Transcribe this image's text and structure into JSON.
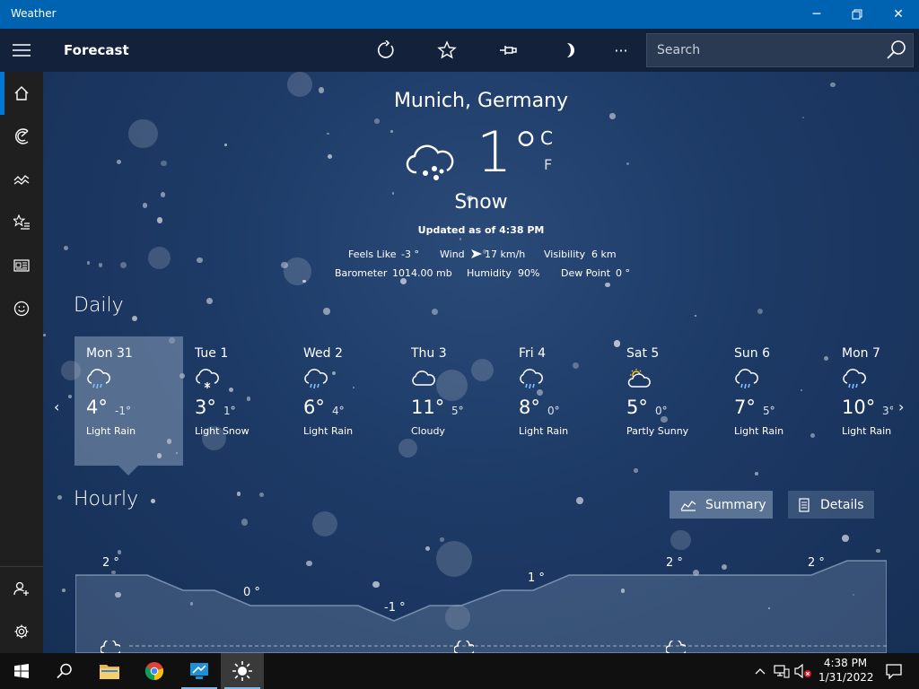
{
  "window": {
    "title": "Weather",
    "minimize": "─",
    "maximize": "□",
    "close": "✕"
  },
  "appbar": {
    "page_title": "Forecast",
    "search_placeholder": "Search",
    "more": "···"
  },
  "current": {
    "city": "Munich, Germany",
    "temp": "1°",
    "unit_c": "C",
    "unit_f": "F",
    "condition": "Snow",
    "updated": "Updated as of 4:38 PM",
    "feels_like_label": "Feels Like",
    "feels_like_value": "-3 °",
    "wind_label": "Wind",
    "wind_value": "17 km/h",
    "visibility_label": "Visibility",
    "visibility_value": "6 km",
    "barometer_label": "Barometer",
    "barometer_value": "1014.00 mb",
    "humidity_label": "Humidity",
    "humidity_value": "90%",
    "dew_point_label": "Dew Point",
    "dew_point_value": "0 °"
  },
  "daily": {
    "title": "Daily",
    "days": [
      {
        "name": "Mon 31",
        "hi": "4°",
        "lo": "-1°",
        "cond": "Light Rain",
        "icon": "light-rain-icon"
      },
      {
        "name": "Tue 1",
        "hi": "3°",
        "lo": "1°",
        "cond": "Light Snow",
        "icon": "light-snow-icon"
      },
      {
        "name": "Wed 2",
        "hi": "6°",
        "lo": "4°",
        "cond": "Light Rain",
        "icon": "light-rain-icon"
      },
      {
        "name": "Thu 3",
        "hi": "11°",
        "lo": "5°",
        "cond": "Cloudy",
        "icon": "cloudy-icon"
      },
      {
        "name": "Fri 4",
        "hi": "8°",
        "lo": "0°",
        "cond": "Light Rain",
        "icon": "light-rain-icon"
      },
      {
        "name": "Sat 5",
        "hi": "5°",
        "lo": "0°",
        "cond": "Partly Sunny",
        "icon": "partly-sunny-icon"
      },
      {
        "name": "Sun 6",
        "hi": "7°",
        "lo": "5°",
        "cond": "Light Rain",
        "icon": "light-rain-icon"
      },
      {
        "name": "Mon 7",
        "hi": "10°",
        "lo": "3°",
        "cond": "Light Rain",
        "icon": "light-rain-icon"
      }
    ]
  },
  "hourly": {
    "title": "Hourly",
    "summary_label": "Summary",
    "details_label": "Details",
    "temps": [
      "2 °",
      "0 °",
      "-1 °",
      "1 °",
      "2 °",
      "2 °"
    ]
  },
  "taskbar": {
    "time": "4:38 PM",
    "date": "1/31/2022"
  },
  "colors": {
    "titlebar": "#0063b1",
    "appbar": "#13223a",
    "sidebar": "#1f1f1f",
    "accent": "#0078d7",
    "sun": "#f3c623"
  }
}
